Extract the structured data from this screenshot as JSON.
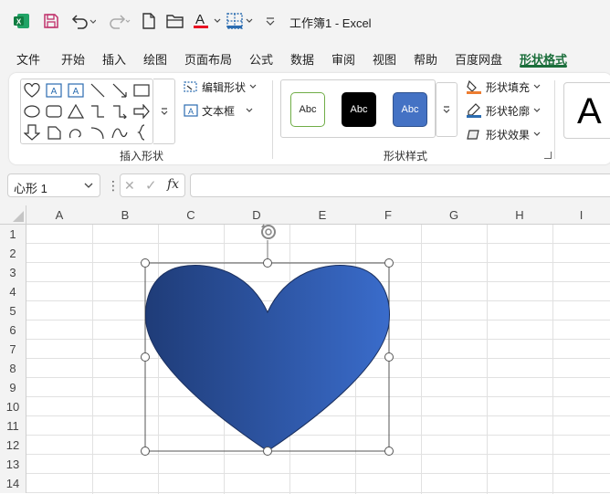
{
  "titlebar": {
    "title": "工作簿1  -  Excel",
    "icons": [
      "excel-logo-icon",
      "save-icon",
      "undo-icon",
      "redo-icon",
      "new-file-icon",
      "open-folder-icon",
      "font-color-icon",
      "borders-icon",
      "customize-qat-icon"
    ],
    "font_color_accent": "#e81123"
  },
  "menu": {
    "tabs": [
      "文件",
      "开始",
      "插入",
      "绘图",
      "页面布局",
      "公式",
      "数据",
      "审阅",
      "视图",
      "帮助",
      "百度网盘",
      "形状格式"
    ],
    "active_tab": "形状格式",
    "active_color": "#1b6e3b"
  },
  "ribbon": {
    "insert_shapes": {
      "label": "插入形状",
      "edit_shape": "编辑形状",
      "text_box": "文本框"
    },
    "shape_styles": {
      "label": "形状样式",
      "presets": [
        {
          "text": "Abc",
          "fill": "#ffffff",
          "border": "#70ad47",
          "color": "#222222"
        },
        {
          "text": "Abc",
          "fill": "#000000",
          "border": "#000000",
          "color": "#ffffff"
        },
        {
          "text": "Abc",
          "fill": "#4472c4",
          "border": "#2f528f",
          "color": "#ffffff"
        }
      ],
      "fill_label": "形状填充",
      "outline_label": "形状轮廓",
      "effects_label": "形状效果"
    },
    "wordart_glyph": "A"
  },
  "formula_bar": {
    "name_box": "心形 1",
    "more": "⋮",
    "cancel": "✕",
    "enter": "✓",
    "fx": "fx",
    "value": ""
  },
  "sheet": {
    "columns": [
      "A",
      "B",
      "C",
      "D",
      "E",
      "F",
      "G",
      "H",
      "I"
    ],
    "rows": [
      "1",
      "2",
      "3",
      "4",
      "5",
      "6",
      "7",
      "8",
      "9",
      "10",
      "11",
      "12",
      "13",
      "14"
    ],
    "shape": {
      "name": "heart",
      "gradient_start": "#1f3c78",
      "gradient_end": "#3a6ccb"
    }
  }
}
